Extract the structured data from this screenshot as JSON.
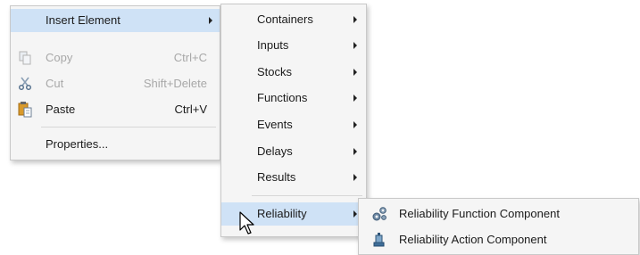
{
  "main_menu": {
    "insert_element": "Insert Element",
    "copy": "Copy",
    "copy_shortcut": "Ctrl+C",
    "cut": "Cut",
    "cut_shortcut": "Shift+Delete",
    "paste": "Paste",
    "paste_shortcut": "Ctrl+V",
    "properties": "Properties..."
  },
  "insert_submenu": {
    "items": [
      "Containers",
      "Inputs",
      "Stocks",
      "Functions",
      "Events",
      "Delays",
      "Results",
      "Reliability"
    ]
  },
  "reliability_submenu": {
    "items": [
      "Reliability Function Component",
      "Reliability Action Component"
    ]
  },
  "colors": {
    "highlight": "#cfe2f6",
    "menu_bg": "#f5f5f5",
    "disabled_text": "#a8a8a8"
  },
  "icons": [
    "copy-icon",
    "cut-icon",
    "paste-icon",
    "gears-icon",
    "action-icon",
    "mouse-pointer-icon"
  ]
}
